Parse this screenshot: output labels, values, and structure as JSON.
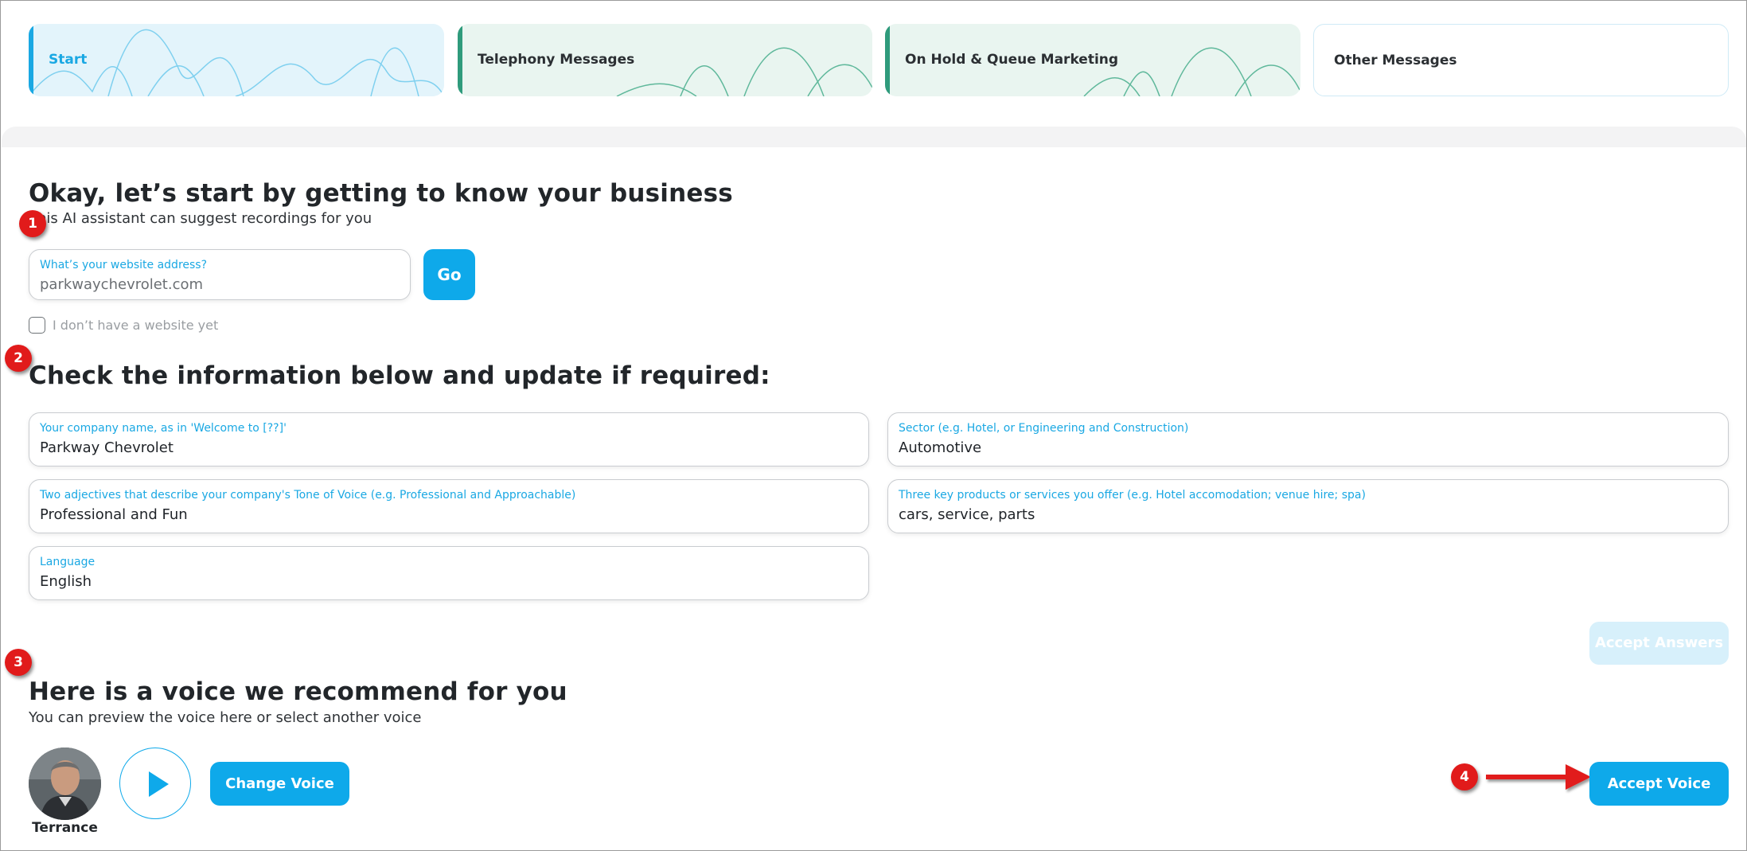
{
  "tabs": [
    {
      "label": "Start"
    },
    {
      "label": "Telephony Messages"
    },
    {
      "label": "On Hold & Queue Marketing"
    },
    {
      "label": "Other Messages"
    }
  ],
  "colors": {
    "primary": "#0ea9ea",
    "accent_teal": "#2f9b7c",
    "label_blue": "#1aa8e3",
    "badge_red": "#e11b1b"
  },
  "steps": [
    "1",
    "2",
    "3",
    "4"
  ],
  "business": {
    "title": "Okay, let’s start by getting to know your business",
    "subtitle": "This AI assistant can suggest recordings for you",
    "website_label": "What’s your website address?",
    "website_value": "parkwaychevrolet.com",
    "go_label": "Go",
    "no_website_label": "I don’t have a website yet"
  },
  "info": {
    "title": "Check the information below and update if required:",
    "fields": [
      {
        "label": "Your company name, as in 'Welcome to [??]'",
        "value": "Parkway Chevrolet"
      },
      {
        "label": "Sector (e.g. Hotel, or Engineering and Construction)",
        "value": "Automotive"
      },
      {
        "label": "Two adjectives that describe your company's Tone of Voice (e.g. Professional and Approachable)",
        "value": "Professional and Fun"
      },
      {
        "label": "Three key products or services you offer (e.g. Hotel accomodation; venue hire; spa)",
        "value": "cars, service, parts"
      },
      {
        "label": "Language",
        "value": "English"
      }
    ],
    "accept_label": "Accept Answers"
  },
  "voice": {
    "title": "Here is a voice we recommend for you",
    "subtitle": "You can preview the voice here or select another voice",
    "name": "Terrance",
    "change_label": "Change Voice",
    "accept_label": "Accept Voice"
  },
  "icons": {
    "play": "play-icon",
    "checkbox": "checkbox-unchecked-icon",
    "arrow": "red-arrow-icon"
  }
}
